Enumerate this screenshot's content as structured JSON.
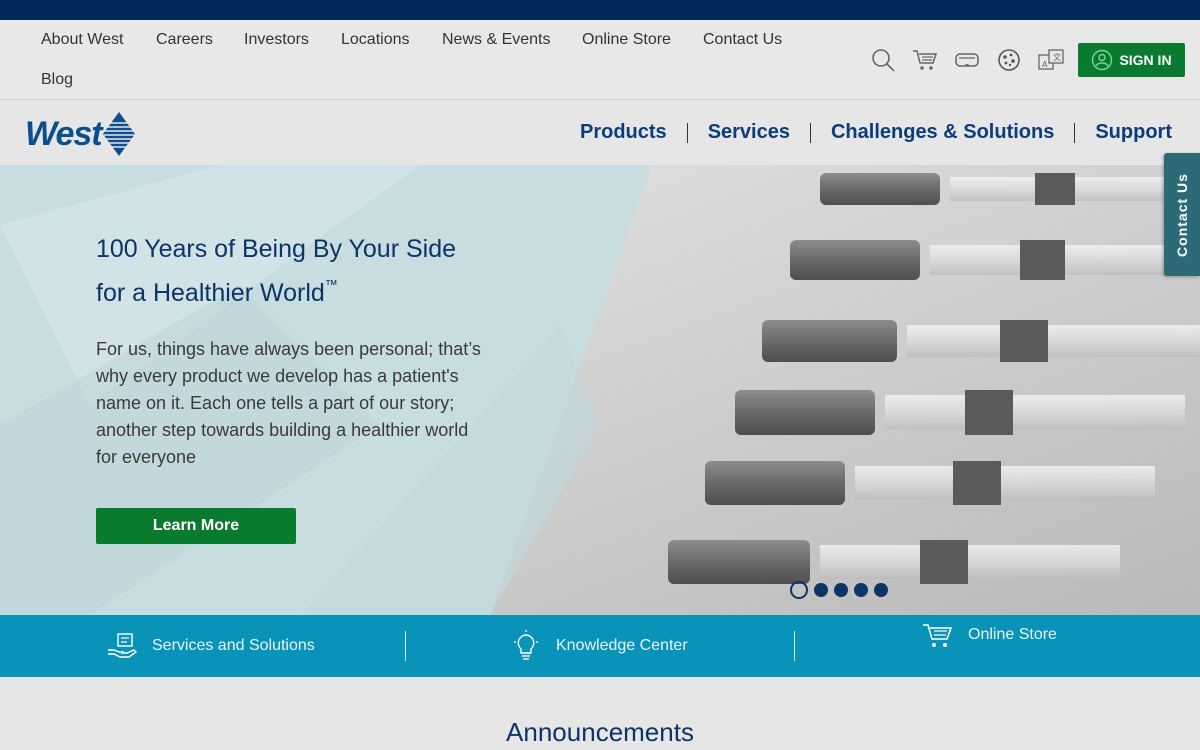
{
  "utility_nav": {
    "links": [
      "About West",
      "Careers",
      "Investors",
      "Locations",
      "News & Events",
      "Online Store",
      "Contact Us",
      "Blog"
    ],
    "icons": [
      "search-icon",
      "cart-icon",
      "vr-headset-icon",
      "cookie-icon",
      "translate-icon"
    ],
    "sign_in": "SIGN IN"
  },
  "brand": {
    "logo_text": "West"
  },
  "main_nav": [
    "Products",
    "Services",
    "Challenges & Solutions",
    "Support"
  ],
  "hero": {
    "title_line1": "100 Years of Being By Your Side",
    "title_line2": "for a Healthier World",
    "title_mark": "™",
    "body": "For us, things have always been personal; that’s why every product we develop has a patient's name on it. Each one tells a part of our story; another step towards building a healthier world for everyone",
    "cta": "Learn More",
    "slides": 5,
    "active_slide": 1
  },
  "contact_tab": "Contact Us",
  "quick_links": [
    {
      "label": "Services and Solutions",
      "icon": "hand-service-icon"
    },
    {
      "label": "Knowledge Center",
      "icon": "lightbulb-icon"
    },
    {
      "label": "Online Store",
      "icon": "cart-icon"
    }
  ],
  "announcements": {
    "heading": "Announcements"
  },
  "colors": {
    "top_bar": "#00285a",
    "accent_green": "#0a7a2f",
    "nav_blue": "#0c3d7a",
    "quickbar_teal": "#0993b8",
    "contact_tab": "#2c6b76"
  }
}
